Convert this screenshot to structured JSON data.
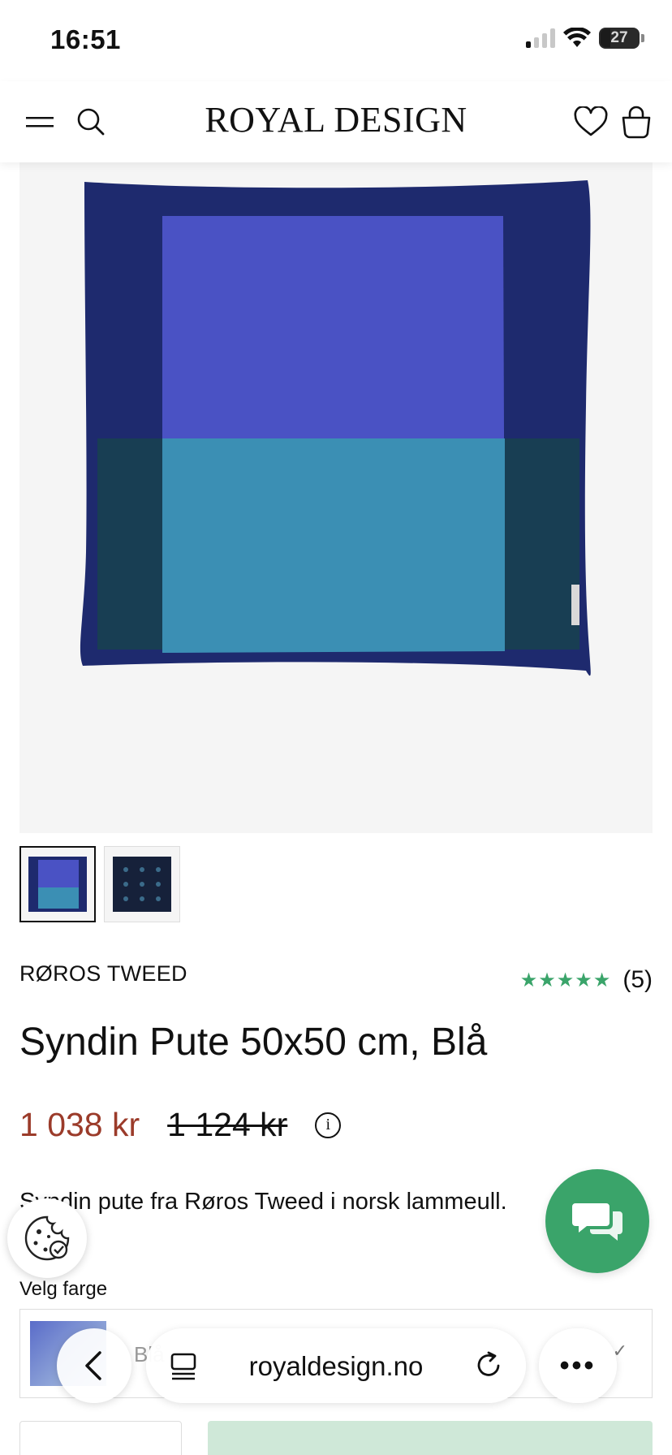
{
  "status_bar": {
    "time": "16:51",
    "battery": "27"
  },
  "header": {
    "brand": "ROYAL DESIGN"
  },
  "product": {
    "brand": "RØROS TWEED",
    "rating_count": "(5)",
    "rating_stars": 5,
    "title": "Syndin Pute 50x50 cm, Blå",
    "price_sale": "1 038 kr",
    "price_original": "1 124 kr",
    "description": "Syndin pute fra Røros Tweed i norsk lammeull."
  },
  "color_select": {
    "label": "Velg farge",
    "value": "Blå"
  },
  "browser": {
    "url": "royaldesign.no"
  },
  "colors": {
    "accent_green": "#3aa46a",
    "sale_price": "#9b3b2a",
    "pillow_blue": "#4a52c4",
    "pillow_teal": "#3b8fb4",
    "pillow_navy": "#1e2a6e"
  }
}
